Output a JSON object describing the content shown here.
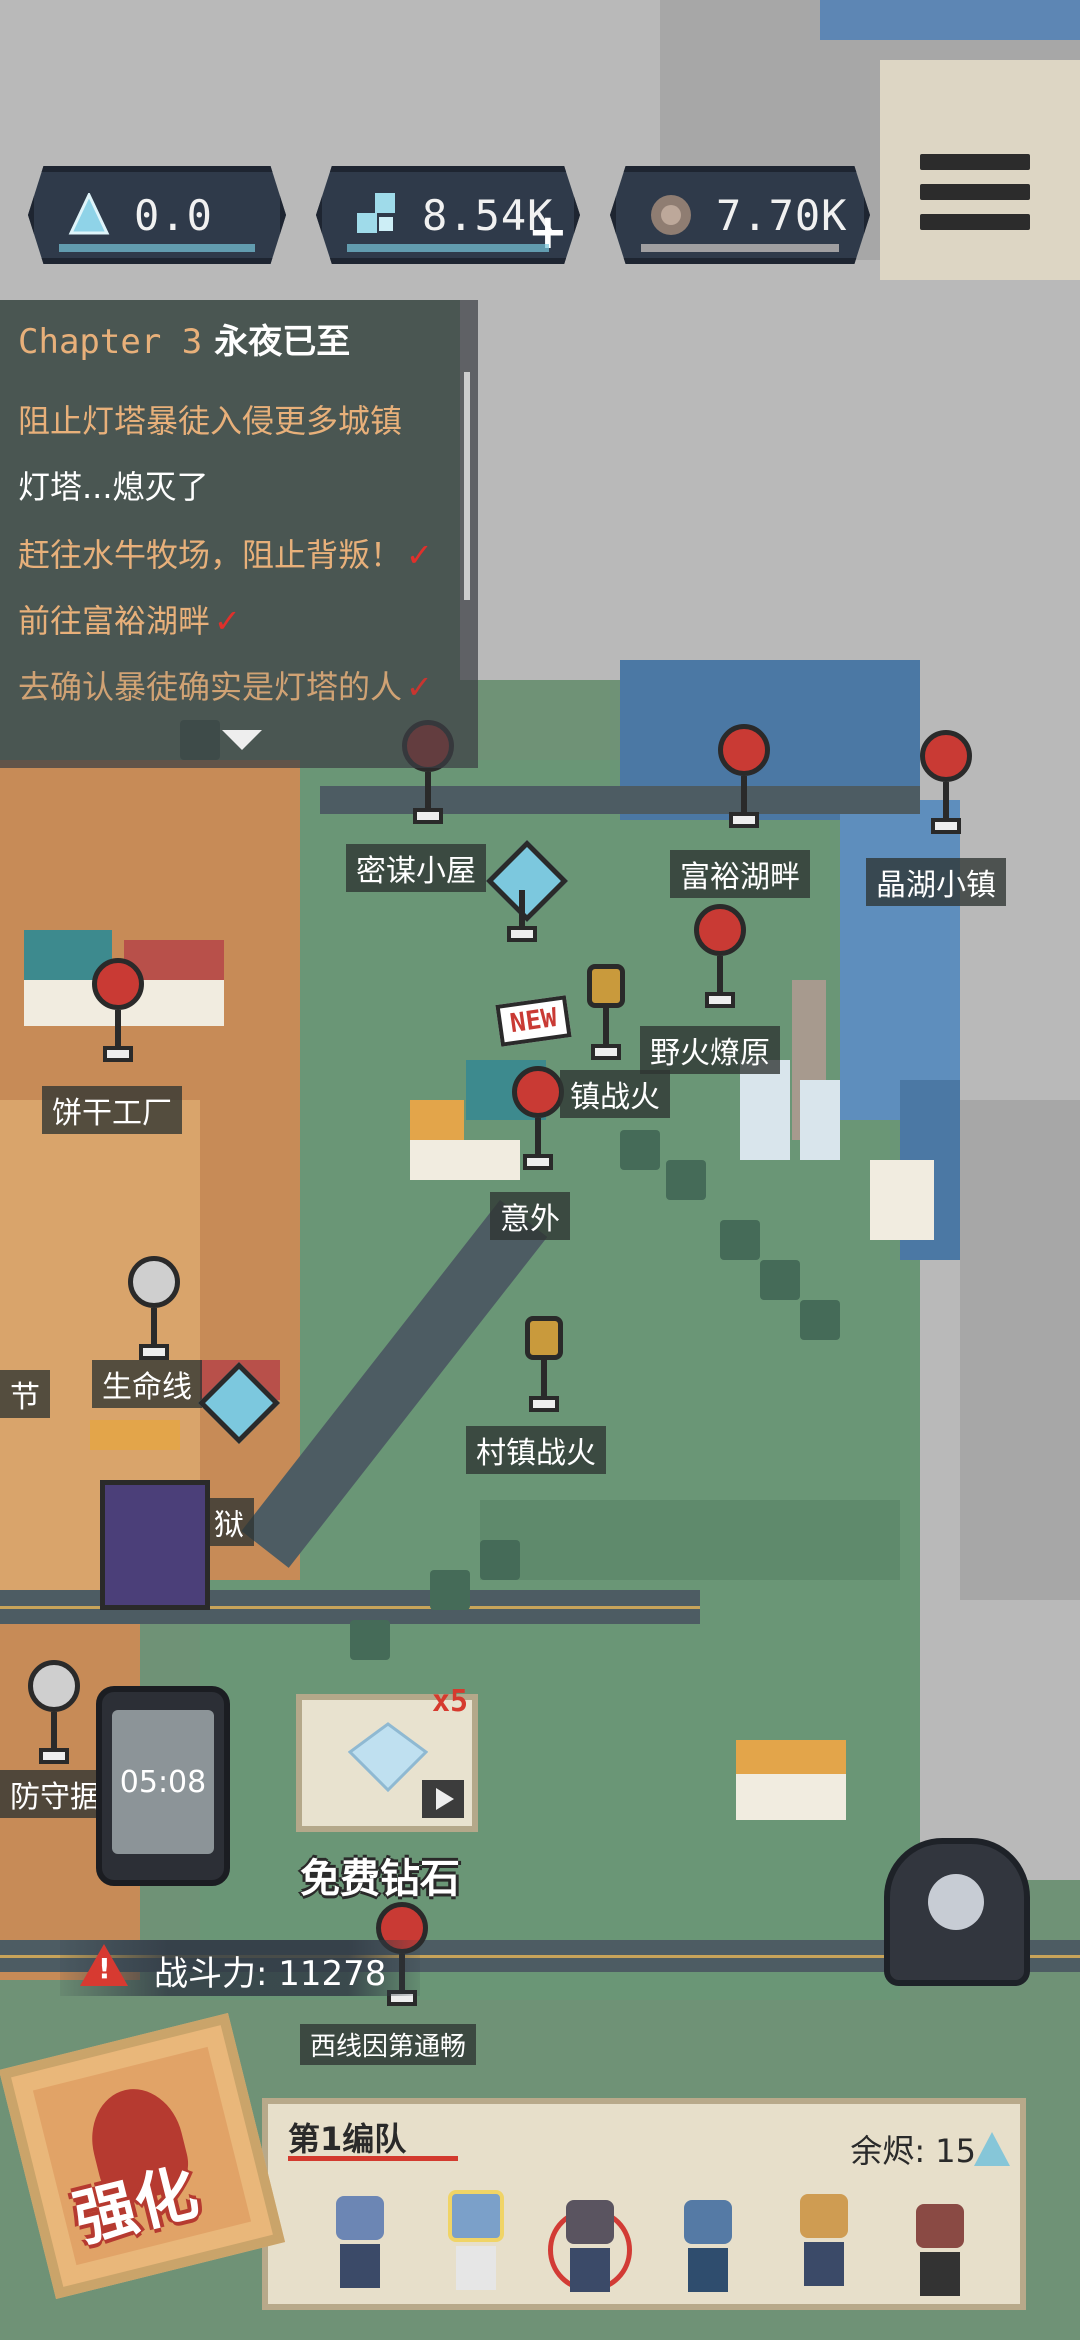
{
  "currencies": [
    {
      "icon": "crystal-icon",
      "value": "0.0"
    },
    {
      "icon": "gem-cluster-icon",
      "value": "8.54K"
    },
    {
      "icon": "ore-icon",
      "value": "7.70K"
    }
  ],
  "add_currency_symbol": "+",
  "quest": {
    "chapter_num": "Chapter 3",
    "chapter_name": "永夜已至",
    "lines": [
      {
        "text": "阻止灯塔暴徒入侵更多城镇",
        "done": false
      },
      {
        "text": "灯塔...熄灭了",
        "done": false
      },
      {
        "text": "赶往水牛牧场，阻止背叛！",
        "done": true
      },
      {
        "text": "前往富裕湖畔",
        "done": true
      },
      {
        "text": "去确认暴徒确实是灯塔的人",
        "done": true
      }
    ],
    "check_symbol": "✓"
  },
  "locations": {
    "secret_hut": "密谋小屋",
    "rich_lake": "富裕湖畔",
    "crystal_lake_town": "晶湖小镇",
    "wildfire_plain": "野火燎原",
    "town_war_1": "镇战火",
    "accident": "意外",
    "biscuit_factory": "饼干工厂",
    "lifeline": "生命线",
    "village_war": "村镇战火",
    "prison_partial": "狱",
    "defense_partial": "防守据点",
    "festival_partial": "节",
    "west_partial": "西线因第通畅"
  },
  "new_badge": "NEW",
  "timer": "05:08",
  "ad_reward": {
    "multiplier": "x5",
    "label": "免费钻石"
  },
  "power": {
    "label": "战斗力:",
    "value": "11278"
  },
  "team": {
    "title": "第1编队",
    "ember_label": "余烬:",
    "ember_value": "15"
  },
  "strengthen_label": "强化",
  "colors": {
    "danger": "#d73a31",
    "crystal": "#86c6d8",
    "quest_done": "#e8b07a"
  }
}
